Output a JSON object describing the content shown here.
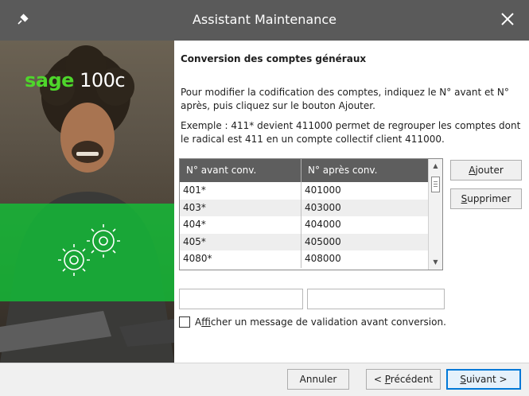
{
  "window": {
    "title": "Assistant Maintenance",
    "close_glyph": "✕",
    "app_icon": "pin-icon"
  },
  "sidebar": {
    "logo_brand": "sage",
    "logo_product": "100c",
    "accent_color": "#4ed62b",
    "band_color": "#12be37"
  },
  "main": {
    "heading": "Conversion des comptes généraux",
    "paragraph1": "Pour modifier la codification des comptes, indiquez le N° avant et N° après, puis cliquez sur le bouton Ajouter.",
    "paragraph2": "Exemple : 411* devient 411000 permet de regrouper les comptes dont le radical est 411 en un compte collectif client 411000."
  },
  "table": {
    "columns": [
      "N° avant conv.",
      "N° après conv."
    ],
    "rows": [
      [
        "401*",
        "401000"
      ],
      [
        "403*",
        "403000"
      ],
      [
        "404*",
        "404000"
      ],
      [
        "405*",
        "405000"
      ],
      [
        "4080*",
        "408000"
      ]
    ]
  },
  "buttons": {
    "add_access": "A",
    "add_rest": "jouter",
    "delete_access": "S",
    "delete_rest": "upprimer"
  },
  "inputs": {
    "before_value": "",
    "after_value": ""
  },
  "option": {
    "checked": false,
    "label_pre": "A",
    "label_access": "f",
    "label_rest": "ficher un message de validation avant conversion."
  },
  "footer": {
    "cancel_label": "Annuler",
    "prev_pre": "< ",
    "prev_access": "P",
    "prev_rest": "récédent",
    "next_access": "S",
    "next_rest": "uivant >"
  }
}
